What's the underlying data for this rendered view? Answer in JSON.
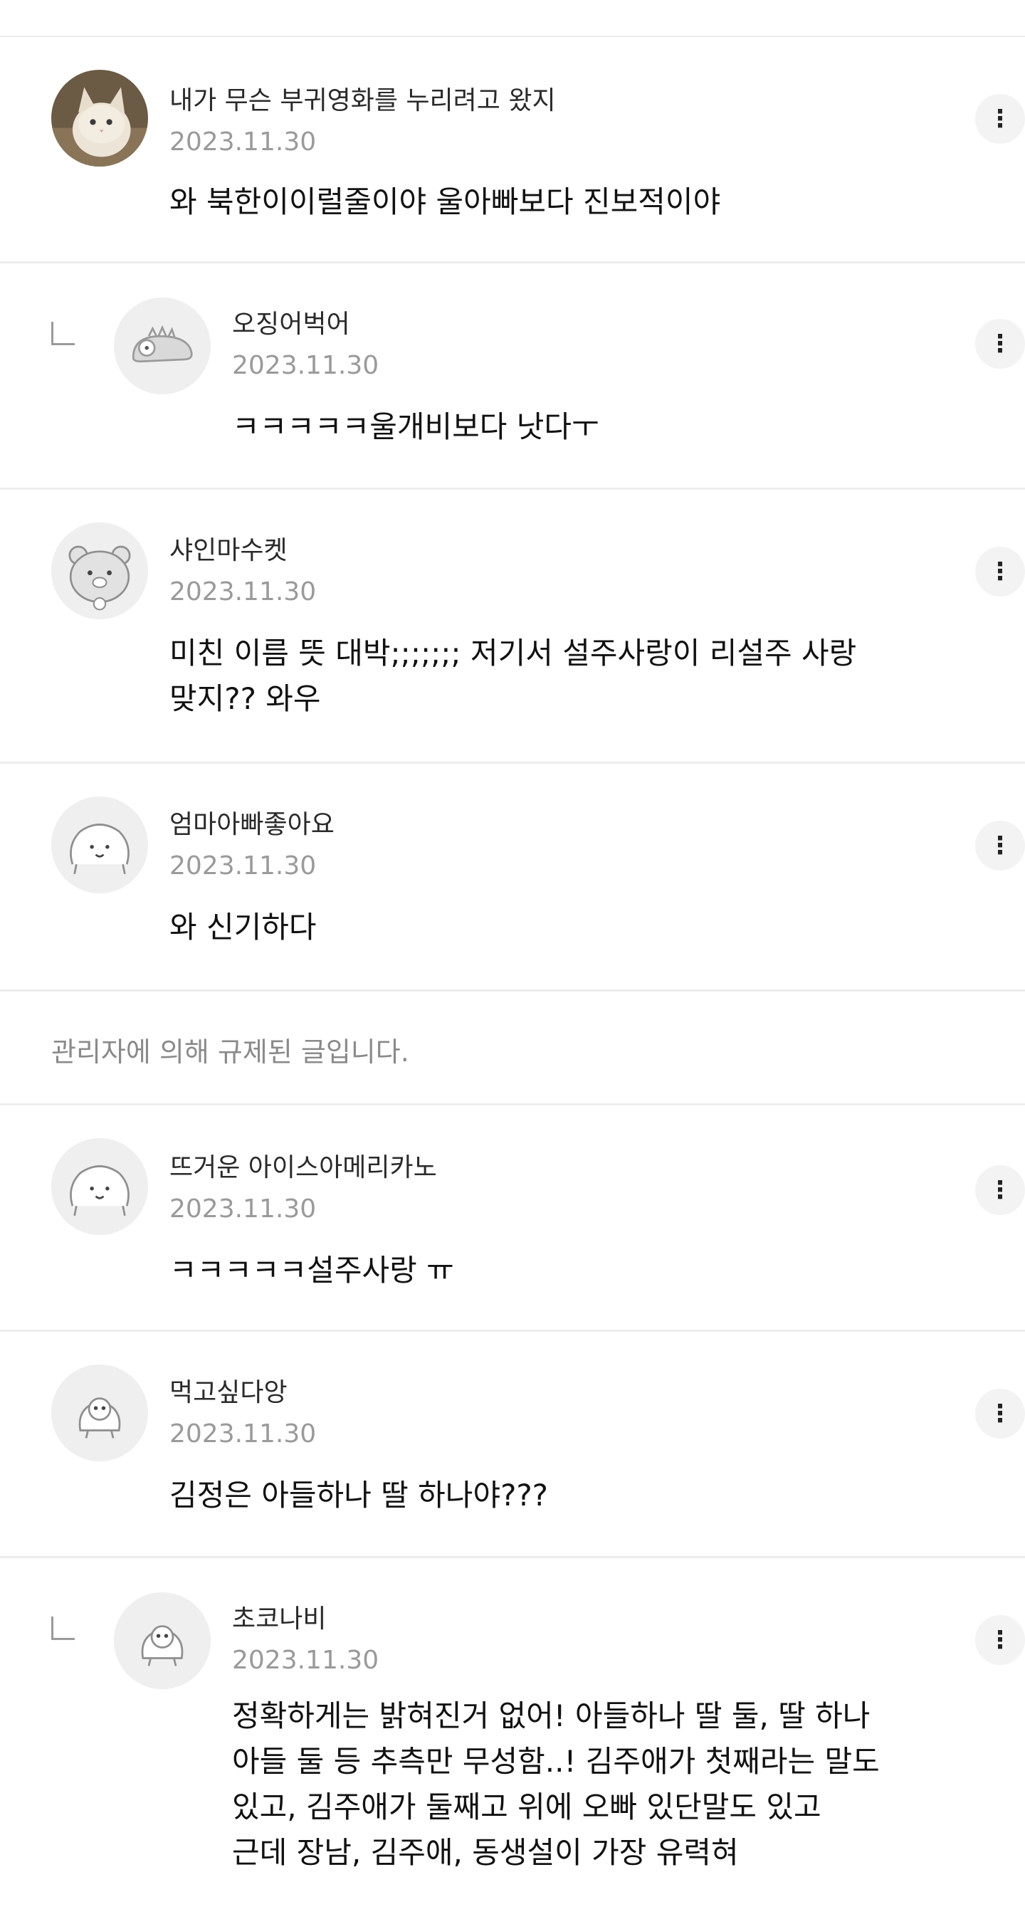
{
  "comments": [
    {
      "name": "내가 무슨 부귀영화를 누리려고 왔지",
      "date": "2023.11.30",
      "text": "와 북한이이럴줄이야 울아빠보다 진보적이야",
      "avatar_icon": "cat-photo-avatar",
      "reply": false
    },
    {
      "name": "오징어벅어",
      "date": "2023.11.30",
      "text": "ㅋㅋㅋㅋㅋ울개비보다 낫다ㅜ",
      "avatar_icon": "dinosaur-avatar",
      "reply": true
    },
    {
      "name": "샤인마수켓",
      "date": "2023.11.30",
      "text": "미친 이름 뜻 대박;;;;;;; 저기서 설주사랑이 리설주 사랑\n맞지?? 와우",
      "avatar_icon": "bear-avatar",
      "reply": false
    },
    {
      "name": "엄마아빠좋아요",
      "date": "2023.11.30",
      "text": "와 신기하다",
      "avatar_icon": "blob-avatar",
      "reply": false
    },
    {
      "name": "뜨거운 아이스아메리카노",
      "date": "2023.11.30",
      "text": "ㅋㅋㅋㅋㅋ설주사랑 ㅠ",
      "avatar_icon": "blob-avatar",
      "reply": false
    },
    {
      "name": "먹고싶다앙",
      "date": "2023.11.30",
      "text": "김정은 아들하나 딸 하나야???",
      "avatar_icon": "gray-blob-avatar",
      "reply": false
    },
    {
      "name": "초코나비",
      "date": "2023.11.30",
      "text": "정확하게는 밝혀진거 없어! 아들하나 딸 둘, 딸 하나\n아들 둘 등 추측만 무성함..! 김주애가 첫째라는 말도\n있고, 김주애가 둘째고 위에 오빠 있단말도 있고\n근데 장남, 김주애, 동생설이 가장 유력혀",
      "avatar_icon": "gray-blob-avatar",
      "reply": true
    }
  ],
  "moderated_notice": "관리자에 의해 규제된 글입니다.",
  "more_icon": "more-vertical-icon",
  "more_glyph": "⋮",
  "colors": {
    "divider": "#ededed",
    "date": "#9a9a9a",
    "notice": "#8a8a8a"
  }
}
